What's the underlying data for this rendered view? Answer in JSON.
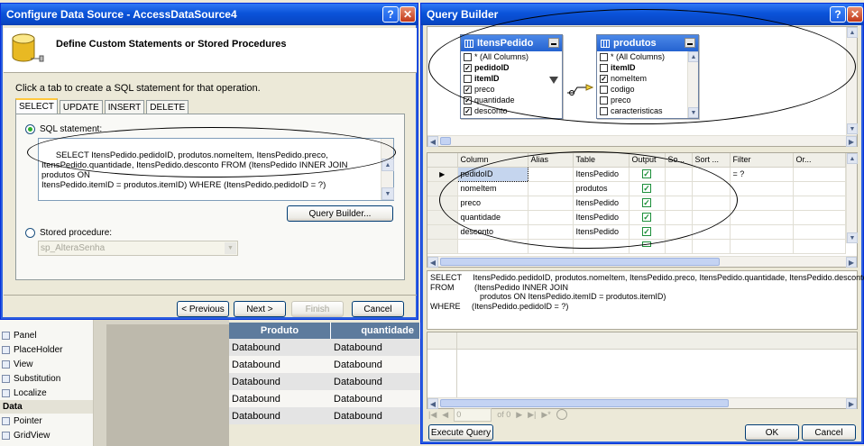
{
  "background": {
    "toolbox": {
      "items": [
        {
          "label": "Panel"
        },
        {
          "label": "PlaceHolder"
        },
        {
          "label": "View"
        },
        {
          "label": "Substitution"
        },
        {
          "label": "Localize"
        }
      ],
      "category": "Data",
      "data_items": [
        {
          "label": "Pointer"
        },
        {
          "label": "GridView"
        }
      ]
    },
    "gridview": {
      "headers": [
        "Produto",
        "quantidade"
      ],
      "rows": [
        [
          "Databound",
          "Databound"
        ],
        [
          "Databound",
          "Databound"
        ],
        [
          "Databound",
          "Databound"
        ],
        [
          "Databound",
          "Databound"
        ],
        [
          "Databound",
          "Databound"
        ]
      ]
    }
  },
  "configure_dialog": {
    "title": "Configure Data Source - AccessDataSource4",
    "heading": "Define Custom Statements or Stored Procedures",
    "instruction": "Click a tab to create a SQL statement for that operation.",
    "tabs": [
      "SELECT",
      "UPDATE",
      "INSERT",
      "DELETE"
    ],
    "active_tab": "SELECT",
    "sql_radio_label": "SQL statement:",
    "sql_text": "SELECT ItensPedido.pedidoID, produtos.nomeItem, ItensPedido.preco,\nItensPedido.quantidade, ItensPedido.desconto FROM (ItensPedido INNER JOIN produtos ON\nItensPedido.itemID = produtos.itemID) WHERE (ItensPedido.pedidoID = ?)",
    "query_builder_button": "Query Builder...",
    "stored_proc_radio_label": "Stored procedure:",
    "stored_proc_value": "sp_AlteraSenha",
    "buttons": {
      "previous": "< Previous",
      "next": "Next >",
      "finish": "Finish",
      "cancel": "Cancel"
    },
    "title_buttons": {
      "help": "?",
      "close": "✕"
    }
  },
  "query_builder": {
    "title": "Query Builder",
    "title_buttons": {
      "help": "?",
      "close": "✕"
    },
    "tables": [
      {
        "name": "ItensPedido",
        "columns": [
          {
            "name": "* (All Columns)",
            "checked": false,
            "key": false
          },
          {
            "name": "pedidoID",
            "checked": true,
            "key": true
          },
          {
            "name": "itemID",
            "checked": false,
            "key": true
          },
          {
            "name": "preco",
            "checked": true,
            "key": false
          },
          {
            "name": "quantidade",
            "checked": true,
            "key": false
          },
          {
            "name": "desconto",
            "checked": true,
            "key": false
          }
        ]
      },
      {
        "name": "produtos",
        "columns": [
          {
            "name": "* (All Columns)",
            "checked": false,
            "key": false
          },
          {
            "name": "itemID",
            "checked": false,
            "key": true
          },
          {
            "name": "nomeItem",
            "checked": true,
            "key": false
          },
          {
            "name": "codigo",
            "checked": false,
            "key": false
          },
          {
            "name": "preco",
            "checked": false,
            "key": false
          },
          {
            "name": "caracteristicas",
            "checked": false,
            "key": false
          }
        ]
      }
    ],
    "grid": {
      "headers": [
        "Column",
        "Alias",
        "Table",
        "Output",
        "So...",
        "Sort ...",
        "Filter",
        "Or..."
      ],
      "rows": [
        {
          "column": "pedidoID",
          "alias": "",
          "table": "ItensPedido",
          "output": true,
          "filter": "= ?"
        },
        {
          "column": "nomeItem",
          "alias": "",
          "table": "produtos",
          "output": true,
          "filter": ""
        },
        {
          "column": "preco",
          "alias": "",
          "table": "ItensPedido",
          "output": true,
          "filter": ""
        },
        {
          "column": "quantidade",
          "alias": "",
          "table": "ItensPedido",
          "output": true,
          "filter": ""
        },
        {
          "column": "desconto",
          "alias": "",
          "table": "ItensPedido",
          "output": true,
          "filter": ""
        }
      ]
    },
    "sql_pane": "SELECT     ItensPedido.pedidoID, produtos.nomeItem, ItensPedido.preco, ItensPedido.quantidade, ItensPedido.desconto\nFROM         (ItensPedido INNER JOIN\n                      produtos ON ItensPedido.itemID = produtos.itemID)\nWHERE     (ItensPedido.pedidoID = ?)",
    "nav": {
      "record": "0",
      "of_label": "of 0"
    },
    "buttons": {
      "execute": "Execute Query",
      "ok": "OK",
      "cancel": "Cancel"
    }
  }
}
